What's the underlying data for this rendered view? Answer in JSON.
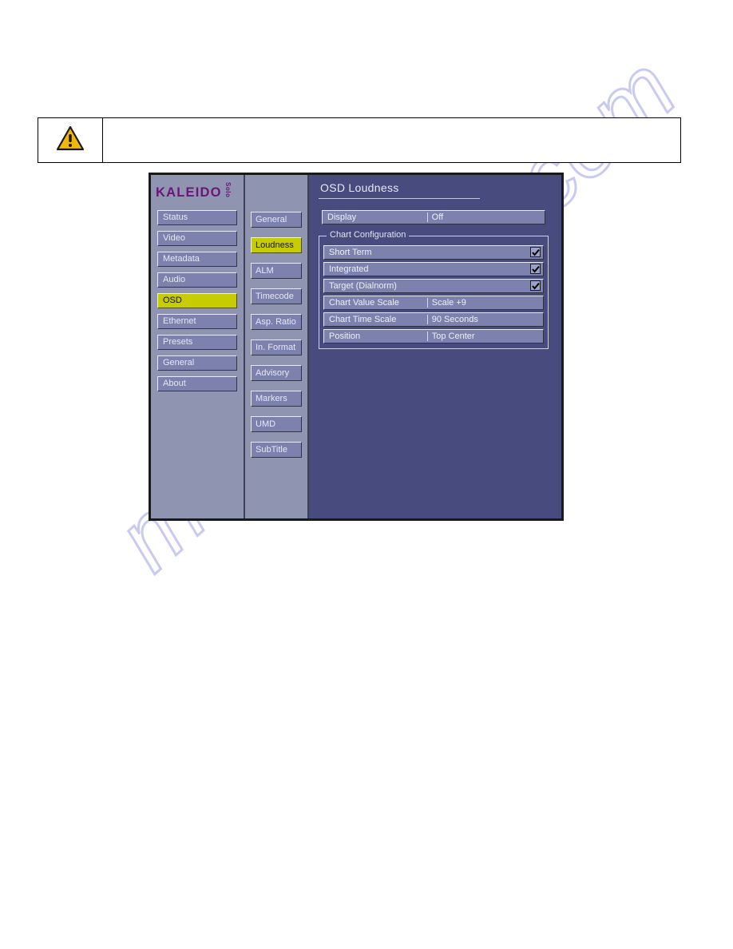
{
  "watermark": {
    "text": "manualshive.com"
  },
  "warning_note": {
    "icon": "warning-triangle-icon",
    "text": ""
  },
  "device_panel": {
    "brand": {
      "name": "KALEIDO",
      "model": "Solo",
      "color": "#6e1478"
    },
    "nav_primary": {
      "items": [
        {
          "label": "Status",
          "selected": false
        },
        {
          "label": "Video",
          "selected": false
        },
        {
          "label": "Metadata",
          "selected": false
        },
        {
          "label": "Audio",
          "selected": false
        },
        {
          "label": "OSD",
          "selected": true
        },
        {
          "label": "Ethernet",
          "selected": false
        },
        {
          "label": "Presets",
          "selected": false
        },
        {
          "label": "General",
          "selected": false
        },
        {
          "label": "About",
          "selected": false
        }
      ]
    },
    "nav_secondary": {
      "items": [
        {
          "label": "General",
          "selected": false
        },
        {
          "label": "Loudness",
          "selected": true
        },
        {
          "label": "ALM",
          "selected": false
        },
        {
          "label": "Timecode",
          "selected": false
        },
        {
          "label": "Asp. Ratio",
          "selected": false
        },
        {
          "label": "In. Format",
          "selected": false
        },
        {
          "label": "Advisory",
          "selected": false
        },
        {
          "label": "Markers",
          "selected": false
        },
        {
          "label": "UMD",
          "selected": false
        },
        {
          "label": "SubTitle",
          "selected": false
        }
      ]
    },
    "content": {
      "title": "OSD Loudness",
      "display_row": {
        "label": "Display",
        "value": "Off"
      },
      "chart_configuration": {
        "group_label": "Chart Configuration",
        "rows": [
          {
            "label": "Short Term",
            "type": "checkbox",
            "checked": true
          },
          {
            "label": "Integrated",
            "type": "checkbox",
            "checked": true
          },
          {
            "label": "Target (Dialnorm)",
            "type": "checkbox",
            "checked": true
          },
          {
            "label": "Chart Value Scale",
            "type": "value",
            "value": "Scale +9"
          },
          {
            "label": "Chart Time Scale",
            "type": "value",
            "value": "90 Seconds"
          },
          {
            "label": "Position",
            "type": "value",
            "value": "Top Center"
          }
        ]
      }
    },
    "colors": {
      "panel_border": "#1a1a1a",
      "nav_background": "#8f94b0",
      "button_fill": "#7c82ad",
      "selected_fill": "#c6cc00",
      "content_background": "#474b7d",
      "text": "#e6e8f6"
    }
  }
}
